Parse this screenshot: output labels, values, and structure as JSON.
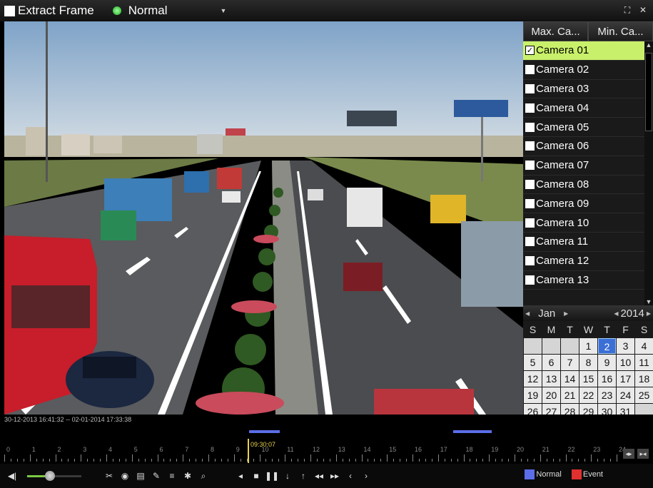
{
  "topbar": {
    "extract_label": "Extract Frame",
    "mode_label": "Normal"
  },
  "camera_panel": {
    "tabs": [
      "Max. Ca...",
      "Min. Ca..."
    ],
    "cameras": [
      {
        "label": "Camera 01",
        "checked": true
      },
      {
        "label": "Camera 02",
        "checked": false
      },
      {
        "label": "Camera 03",
        "checked": false
      },
      {
        "label": "Camera 04",
        "checked": false
      },
      {
        "label": "Camera 05",
        "checked": false
      },
      {
        "label": "Camera 06",
        "checked": false
      },
      {
        "label": "Camera 07",
        "checked": false
      },
      {
        "label": "Camera 08",
        "checked": false
      },
      {
        "label": "Camera 09",
        "checked": false
      },
      {
        "label": "Camera 10",
        "checked": false
      },
      {
        "label": "Camera 11",
        "checked": false
      },
      {
        "label": "Camera 12",
        "checked": false
      },
      {
        "label": "Camera 13",
        "checked": false
      }
    ]
  },
  "calendar": {
    "month": "Jan",
    "year": "2014",
    "weekdays": [
      "S",
      "M",
      "T",
      "W",
      "T",
      "F",
      "S"
    ],
    "leading_blanks": 3,
    "days": 31,
    "selected_day": 2,
    "trailing_blank_cells": 12
  },
  "timeline": {
    "range": "30-12-2013 16:41:32 -- 02-01-2014 17:33:38",
    "cursor_time": "09:30:07",
    "hour_labels": [
      "0",
      "1",
      "2",
      "3",
      "4",
      "5",
      "6",
      "7",
      "8",
      "9",
      "10",
      "11",
      "12",
      "13",
      "14",
      "15",
      "16",
      "17",
      "18",
      "19",
      "20",
      "21",
      "22",
      "23",
      "24"
    ],
    "recorded_segments_hours": [
      [
        9.6,
        10.8
      ],
      [
        17.6,
        19.1
      ]
    ]
  },
  "playback": {
    "volume_fraction": 0.42
  },
  "legend": {
    "normal_label": "Normal",
    "event_label": "Event",
    "normal_color": "#5b6ee8",
    "event_color": "#e03030"
  }
}
